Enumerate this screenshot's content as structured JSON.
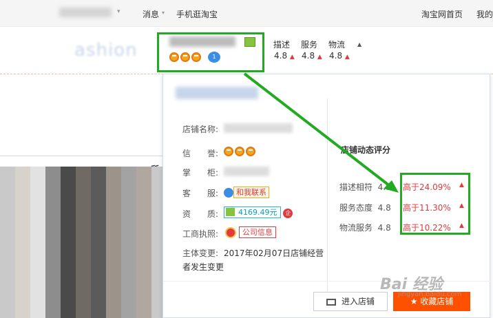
{
  "topbar": {
    "user_name": "",
    "messages": "消息",
    "mobile_taobao": "手机逛淘宝",
    "taobao_home": "淘宝网首页",
    "mine": "我的"
  },
  "logo": {
    "text": "ashion"
  },
  "shop": {
    "crowns": 3,
    "badge": "1"
  },
  "ratings": {
    "describe_label": "描述",
    "describe_value": "4.8",
    "service_label": "服务",
    "service_value": "4.8",
    "logistics_label": "物流",
    "logistics_value": "4.8"
  },
  "background": {
    "side_text": "所"
  },
  "popup": {
    "shop_name_label": "店铺名称:",
    "reputation_label": "信　　誉:",
    "keeper_label": "掌　　柜:",
    "service_label": "客　　服:",
    "contact_button": "和我联系",
    "qualification_label": "资　　质:",
    "deposit_amount": "4169.49元",
    "deposit_icon": "企",
    "license_label": "工商执照:",
    "license_button": "公司信息",
    "change_label": "主体变更:",
    "change_text_line1": "2017年02月07日店铺经营",
    "change_text_line2": "者发生变更",
    "dynamic_title": "店铺动态评分",
    "dynamic_rows": [
      {
        "label": "描述相符",
        "score": "4.8",
        "compare": "高于24.09%"
      },
      {
        "label": "服务态度",
        "score": "4.8",
        "compare": "高于11.30%"
      },
      {
        "label": "物流服务",
        "score": "4.8",
        "compare": "高于10.22%"
      }
    ],
    "enter_store_button": "进入店铺",
    "favorite_store_button": "收藏店铺"
  },
  "watermark": {
    "text": "Bai 经验",
    "sub": "jingyan.baidu.com"
  },
  "colors": {
    "annotation_green": "#22aa22",
    "accent_orange": "#ff5000",
    "up_red": "#e4393c"
  }
}
